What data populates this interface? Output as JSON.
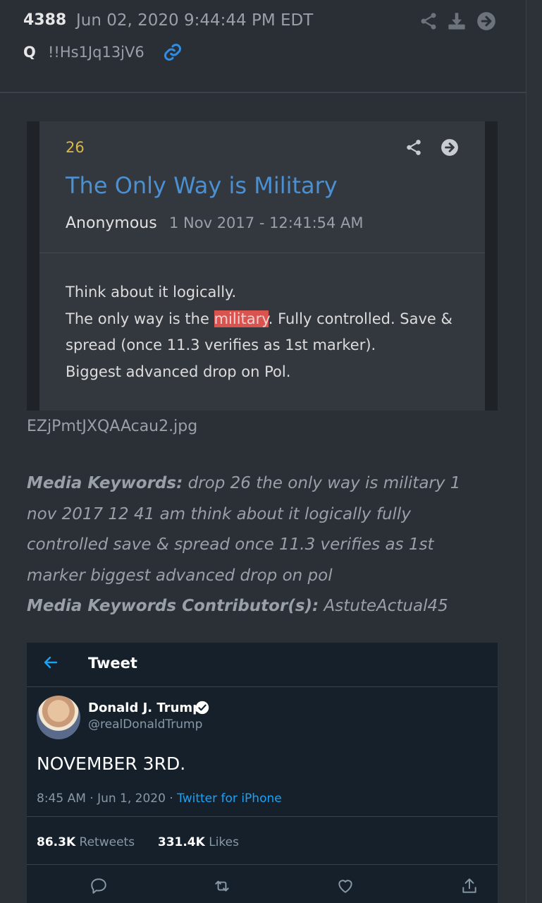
{
  "header": {
    "post_number": "4388",
    "date": "Jun 02, 2020 9:44:44 PM EDT",
    "author": "Q",
    "tripcode": "!!Hs1Jq13jV6",
    "icons": [
      "share-icon",
      "download-icon",
      "arrow-right-circle-icon",
      "link-icon"
    ]
  },
  "drop": {
    "number": "26",
    "title": "The Only Way is Military",
    "author": "Anonymous",
    "date": "1 Nov 2017 - 12:41:54 AM",
    "line1": "Think about it logically.",
    "line2_pre": "The only way is the ",
    "line2_highlight": "military",
    "line2_post": ". Fully controlled. Save & spread (once 11.3 verifies as 1st marker).",
    "line3": "Biggest advanced drop on Pol."
  },
  "media": {
    "filename": "EZjPmtJXQAAcau2.jpg",
    "keywords_label": "Media Keywords:",
    "keywords": " drop 26 the only way is military 1 nov 2017 12 41 am think about it logically fully controlled save & spread once 11.3 verifies as 1st marker biggest advanced drop on pol",
    "contributors_label": "Media Keywords Contributor(s):",
    "contributors": " AstuteActual45"
  },
  "tweet": {
    "header_title": "Tweet",
    "name": "Donald J. Trump",
    "handle": "@realDonaldTrump",
    "text": "NOVEMBER 3RD.",
    "time": "8:45 AM · Jun 1, 2020 · ",
    "source": "Twitter for iPhone",
    "retweets": "86.3K",
    "retweets_label": " Retweets",
    "likes": "331.4K",
    "likes_label": " Likes"
  },
  "colors": {
    "background": "#2b2f36",
    "title_blue": "#4a90d2",
    "drop_number_gold": "#d9b84c",
    "highlight_red": "#d9534f",
    "tweet_bg": "#15202b",
    "twitter_blue": "#1da1f2"
  }
}
